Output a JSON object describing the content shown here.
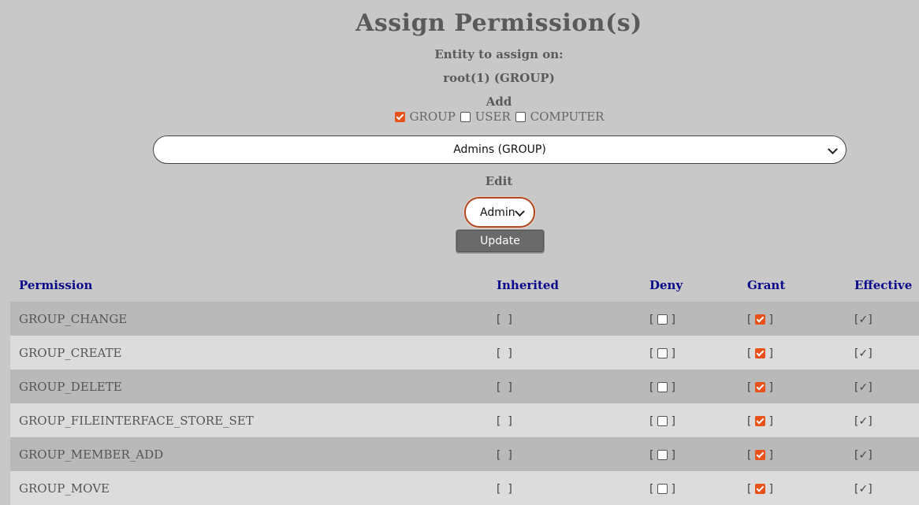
{
  "page": {
    "title": "Assign Permission(s)",
    "entity_label": "Entity to assign on:",
    "entity_value": "root(1) (GROUP)",
    "add_label": "Add",
    "edit_label": "Edit"
  },
  "filters": [
    {
      "label": "GROUP",
      "checked": true
    },
    {
      "label": "USER",
      "checked": false
    },
    {
      "label": "COMPUTER",
      "checked": false
    }
  ],
  "add_select": {
    "value": "Admins (GROUP)"
  },
  "edit_select": {
    "value": "Admins (GROUP)"
  },
  "update_button": {
    "label": "Update"
  },
  "accent_color": "#e8511a",
  "table": {
    "headers": {
      "permission": "Permission",
      "inherited": "Inherited",
      "deny": "Deny",
      "grant": "Grant",
      "effective": "Effective"
    },
    "rows": [
      {
        "permission": "GROUP_CHANGE",
        "inherited": "[  ]",
        "deny": false,
        "grant": true,
        "effective": "[✓]"
      },
      {
        "permission": "GROUP_CREATE",
        "inherited": "[  ]",
        "deny": false,
        "grant": true,
        "effective": "[✓]"
      },
      {
        "permission": "GROUP_DELETE",
        "inherited": "[  ]",
        "deny": false,
        "grant": true,
        "effective": "[✓]"
      },
      {
        "permission": "GROUP_FILEINTERFACE_STORE_SET",
        "inherited": "[  ]",
        "deny": false,
        "grant": true,
        "effective": "[✓]"
      },
      {
        "permission": "GROUP_MEMBER_ADD",
        "inherited": "[  ]",
        "deny": false,
        "grant": true,
        "effective": "[✓]"
      },
      {
        "permission": "GROUP_MOVE",
        "inherited": "[  ]",
        "deny": false,
        "grant": true,
        "effective": "[✓]"
      }
    ]
  }
}
